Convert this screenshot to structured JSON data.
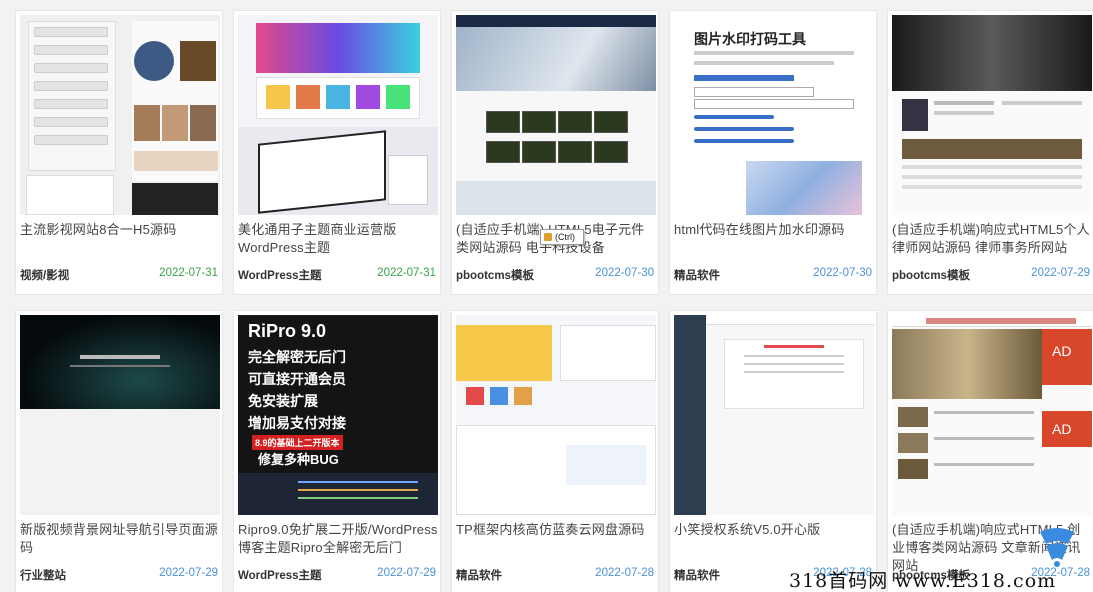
{
  "cards": [
    {
      "title": "主流影视网站8合一H5源码",
      "category": "视频/影视",
      "date": "2022-07-31",
      "date_color": "green"
    },
    {
      "title": "美化通用子主题商业运营版WordPress主题",
      "category": "WordPress主题",
      "date": "2022-07-31",
      "date_color": "green"
    },
    {
      "title": "(自适应手机端)    HTML5电子元件类网站源码 电子科技设备",
      "category": "pbootcms模板",
      "date": "2022-07-30",
      "date_color": "blue"
    },
    {
      "title": "html代码在线图片加水印源码",
      "category": "精品软件",
      "date": "2022-07-30",
      "date_color": "blue"
    },
    {
      "title": "(自适应手机端)响应式HTML5个人律师网站源码 律师事务所网站",
      "category": "pbootcms模板",
      "date": "2022-07-29",
      "date_color": "blue"
    },
    {
      "title": "新版视频背景网址导航引导页面源码",
      "category": "行业整站",
      "date": "2022-07-29",
      "date_color": "blue"
    },
    {
      "title": "Ripro9.0免扩展二开版/WordPress博客主题Ripro全解密无后门",
      "category": "WordPress主题",
      "date": "2022-07-29",
      "date_color": "blue"
    },
    {
      "title": "TP框架内核高仿蓝奏云网盘源码",
      "category": "精品软件",
      "date": "2022-07-28",
      "date_color": "blue"
    },
    {
      "title": "小笑授权系统V5.0开心版",
      "category": "精品软件",
      "date": "2022-07-28",
      "date_color": "blue"
    },
    {
      "title": "(自适应手机端)响应式HTML5 创业博客类网站源码 文章新闻资讯网站",
      "category": "pbootcms模板",
      "date": "2022-07-28",
      "date_color": "blue"
    }
  ],
  "thumbs": {
    "watermark_tool_title": "图片水印打码工具",
    "ripro_title": "RiPro 9.0",
    "ripro_lines": [
      "完全解密无后门",
      "可直接开通会员",
      "免安装扩展",
      "增加易支付对接",
      "8.9的基础上二开版本",
      "修复多种BUG"
    ],
    "ad_label": "AD"
  },
  "tooltip": "(Ctrl)",
  "watermark": "318首码网 www.E318.com",
  "colors": {
    "green_date": "#3aa24a",
    "blue_date": "#4a90d9"
  }
}
